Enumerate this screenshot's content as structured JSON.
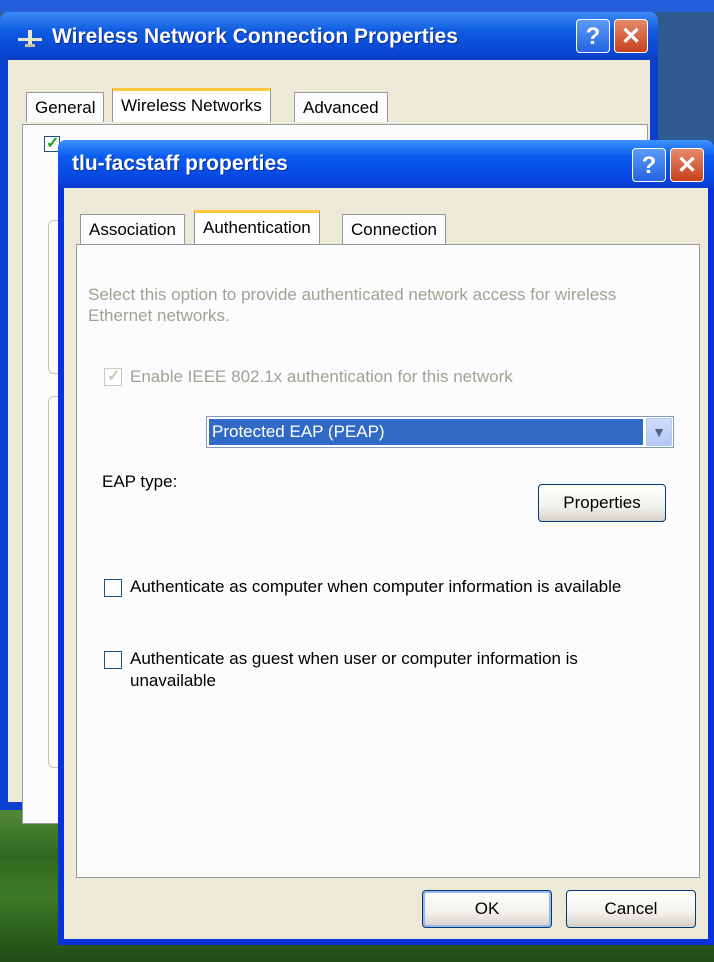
{
  "back_window": {
    "title": "Wireless Network Connection Properties",
    "tabs": [
      {
        "label": "General"
      },
      {
        "label": "Wireless Networks"
      },
      {
        "label": "Advanced"
      }
    ],
    "active_tab": "Wireless Networks"
  },
  "dialog": {
    "title": "tlu-facstaff properties",
    "tabs": [
      {
        "label": "Association"
      },
      {
        "label": "Authentication"
      },
      {
        "label": "Connection"
      }
    ],
    "active_tab": "Authentication",
    "description": "Select this option to provide authenticated network access for wireless Ethernet networks.",
    "enable_ieee": {
      "label": "Enable IEEE 802.1x authentication for this network",
      "checked": true,
      "enabled": false
    },
    "eap_type": {
      "label": "EAP type:",
      "value": "Protected EAP (PEAP)"
    },
    "properties_button": "Properties",
    "auth_computer": {
      "label": "Authenticate as computer when computer information is available",
      "checked": false
    },
    "auth_guest": {
      "label_line1": "Authenticate as guest when user or computer information is",
      "label_line2": "unavailable",
      "checked": false
    },
    "ok_button": "OK",
    "cancel_button": "Cancel"
  },
  "title_buttons": {
    "help": "?",
    "close": "✕"
  },
  "colors": {
    "titlebar": "#0a5cf0",
    "dialog_face": "#ece9d8",
    "selection": "#316ac5",
    "disabled_text": "#a3a192"
  }
}
